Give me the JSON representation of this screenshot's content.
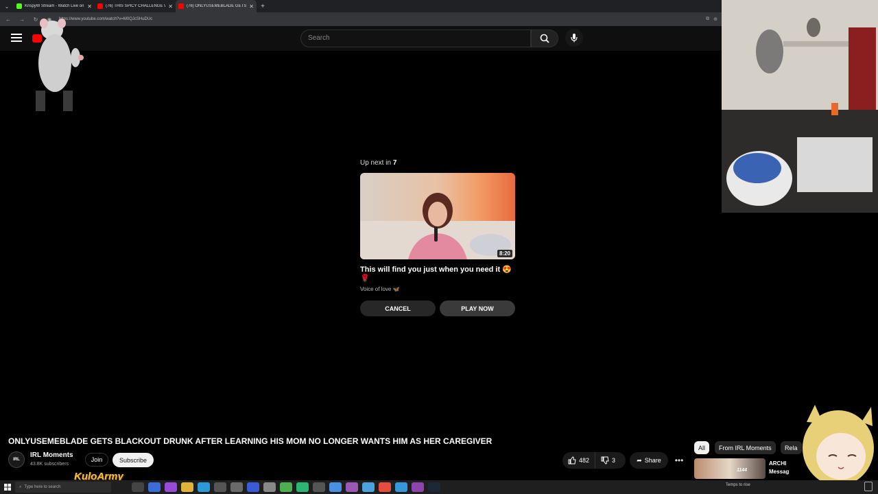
{
  "browser": {
    "tabs": [
      {
        "label": "KrispyW Stream - Watch Live on K",
        "color": "#53fc18",
        "active": false
      },
      {
        "label": "(76) THIS SPICY CHALLENGE WITH",
        "color": "#ff0000",
        "active": false
      },
      {
        "label": "(76) ONLYUSEMEBLADE GETS",
        "color": "#ff0000",
        "active": true
      }
    ],
    "url": "https://www.youtube.com/watch?v=M0QJcSHuDUc"
  },
  "header": {
    "search_placeholder": "Search"
  },
  "up_next": {
    "label_prefix": "Up next in ",
    "countdown": "7",
    "duration": "8:20",
    "title": "This will find you just when you need it 😍🌹",
    "channel": "Voice of love 🦋",
    "cancel_label": "CANCEL",
    "play_label": "PLAY NOW"
  },
  "video": {
    "title": "ONLYUSEMEBLADE GETS BLACKOUT DRUNK AFTER LEARNING HIS MOM NO LONGER WANTS HIM AS HER CAREGIVER",
    "channel_avatar": "IRL",
    "channel_name": "IRL Moments",
    "subscribers": "43.8K subscribers",
    "join_label": "Join",
    "subscribe_label": "Subscribe",
    "likes": "482",
    "dislikes": "3",
    "share_label": "Share"
  },
  "chips": [
    "All",
    "From IRL Moments",
    "Rela"
  ],
  "sidebar_video": {
    "title_line1": "ARCHI",
    "title_line2": "Messag",
    "thumb_badge": "1144"
  },
  "overlay": {
    "kuloarmy": "KuloArmy"
  },
  "taskbar": {
    "search_placeholder": "Type here to search",
    "weather": "Temps to rise"
  },
  "colors": {
    "youtube_red": "#ff0000",
    "kick_green": "#53fc18",
    "background": "#0f0f0f"
  }
}
